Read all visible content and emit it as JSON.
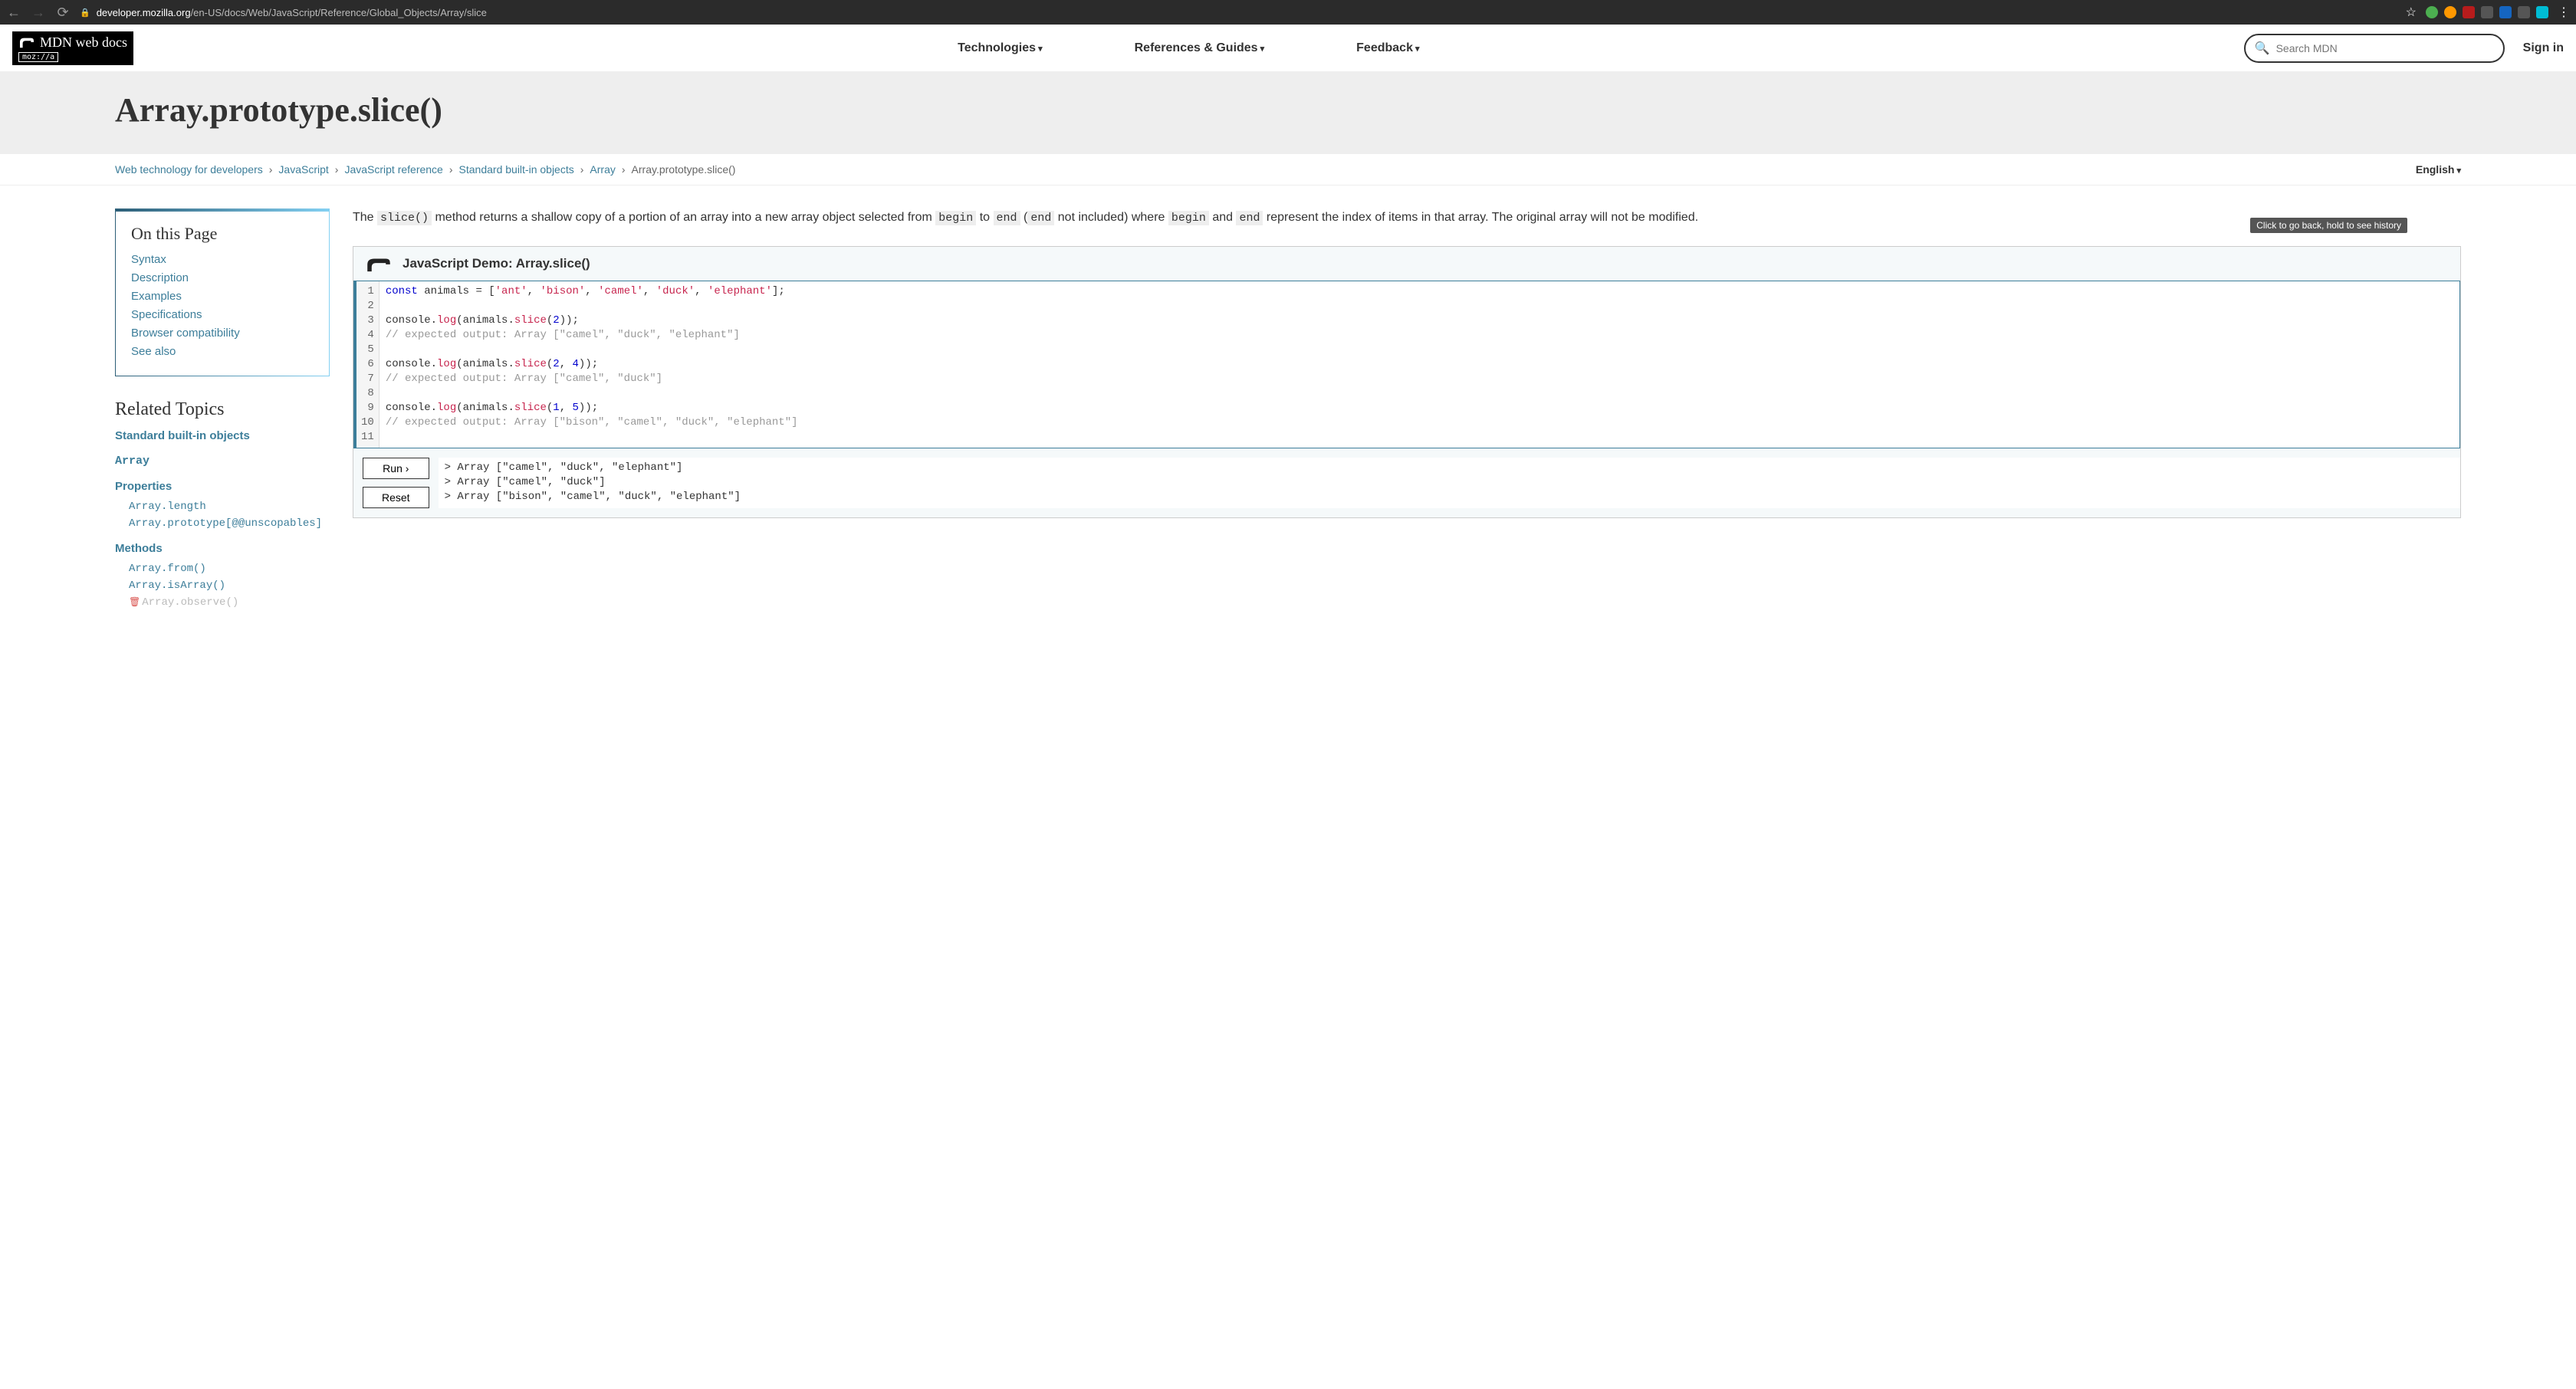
{
  "browser": {
    "url_prefix": "developer.mozilla.org",
    "url_path": "/en-US/docs/Web/JavaScript/Reference/Global_Objects/Array/slice"
  },
  "nav": {
    "technologies": "Technologies",
    "references": "References & Guides",
    "feedback": "Feedback",
    "search_placeholder": "Search MDN",
    "sign_in": "Sign in",
    "logo_text": "MDN web docs",
    "moz": "moz://a"
  },
  "title": "Array.prototype.slice()",
  "breadcrumb": {
    "items": [
      "Web technology for developers",
      "JavaScript",
      "JavaScript reference",
      "Standard built-in objects",
      "Array"
    ],
    "current": "Array.prototype.slice()",
    "language": "English"
  },
  "tooltip": "Click to go back, hold to see history",
  "on_this_page": {
    "heading": "On this Page",
    "items": [
      "Syntax",
      "Description",
      "Examples",
      "Specifications",
      "Browser compatibility",
      "See also"
    ]
  },
  "related": {
    "heading": "Related Topics",
    "top_link": "Standard built-in objects",
    "category": "Array",
    "properties_head": "Properties",
    "properties": [
      "Array.length",
      "Array.prototype[@@unscopables]"
    ],
    "methods_head": "Methods",
    "methods": [
      "Array.from()",
      "Array.isArray()"
    ],
    "deprecated": "Array.observe()"
  },
  "prose": {
    "p1_a": "The ",
    "p1_code1": "slice()",
    "p1_b": " method returns a shallow copy of a portion of an array into a new array object selected from ",
    "p1_code2": "begin",
    "p1_c": " to ",
    "p1_code3": "end",
    "p1_d": " (",
    "p1_code4": "end",
    "p1_e": " not included) where ",
    "p1_code5": "begin",
    "p1_f": " and ",
    "p1_code6": "end",
    "p1_g": " represent the index of items in that array. The original array will not be modified."
  },
  "demo": {
    "title": "JavaScript Demo: Array.slice()",
    "run": "Run ›",
    "reset": "Reset",
    "code_lines": [
      {
        "n": 1,
        "tokens": [
          [
            "kw",
            "const"
          ],
          [
            "",
            " animals = ["
          ],
          [
            "str",
            "'ant'"
          ],
          [
            "",
            ", "
          ],
          [
            "str",
            "'bison'"
          ],
          [
            "",
            ", "
          ],
          [
            "str",
            "'camel'"
          ],
          [
            "",
            ", "
          ],
          [
            "str",
            "'duck'"
          ],
          [
            "",
            ", "
          ],
          [
            "str",
            "'elephant'"
          ],
          [
            "",
            "];"
          ]
        ]
      },
      {
        "n": 2,
        "tokens": []
      },
      {
        "n": 3,
        "tokens": [
          [
            "",
            "console."
          ],
          [
            "fn",
            "log"
          ],
          [
            "",
            "(animals."
          ],
          [
            "fn",
            "slice"
          ],
          [
            "",
            "("
          ],
          [
            "num",
            "2"
          ],
          [
            "",
            "));"
          ]
        ]
      },
      {
        "n": 4,
        "tokens": [
          [
            "com",
            "// expected output: Array [\"camel\", \"duck\", \"elephant\"]"
          ]
        ]
      },
      {
        "n": 5,
        "tokens": []
      },
      {
        "n": 6,
        "tokens": [
          [
            "",
            "console."
          ],
          [
            "fn",
            "log"
          ],
          [
            "",
            "(animals."
          ],
          [
            "fn",
            "slice"
          ],
          [
            "",
            "("
          ],
          [
            "num",
            "2"
          ],
          [
            "",
            ", "
          ],
          [
            "num",
            "4"
          ],
          [
            "",
            "));"
          ]
        ]
      },
      {
        "n": 7,
        "tokens": [
          [
            "com",
            "// expected output: Array [\"camel\", \"duck\"]"
          ]
        ]
      },
      {
        "n": 8,
        "tokens": []
      },
      {
        "n": 9,
        "tokens": [
          [
            "",
            "console."
          ],
          [
            "fn",
            "log"
          ],
          [
            "",
            "(animals."
          ],
          [
            "fn",
            "slice"
          ],
          [
            "",
            "("
          ],
          [
            "num",
            "1"
          ],
          [
            "",
            ", "
          ],
          [
            "num",
            "5"
          ],
          [
            "",
            "));"
          ]
        ]
      },
      {
        "n": 10,
        "tokens": [
          [
            "com",
            "// expected output: Array [\"bison\", \"camel\", \"duck\", \"elephant\"]"
          ]
        ]
      },
      {
        "n": 11,
        "tokens": []
      }
    ],
    "output": [
      "> Array [\"camel\", \"duck\", \"elephant\"]",
      "> Array [\"camel\", \"duck\"]",
      "> Array [\"bison\", \"camel\", \"duck\", \"elephant\"]"
    ]
  }
}
